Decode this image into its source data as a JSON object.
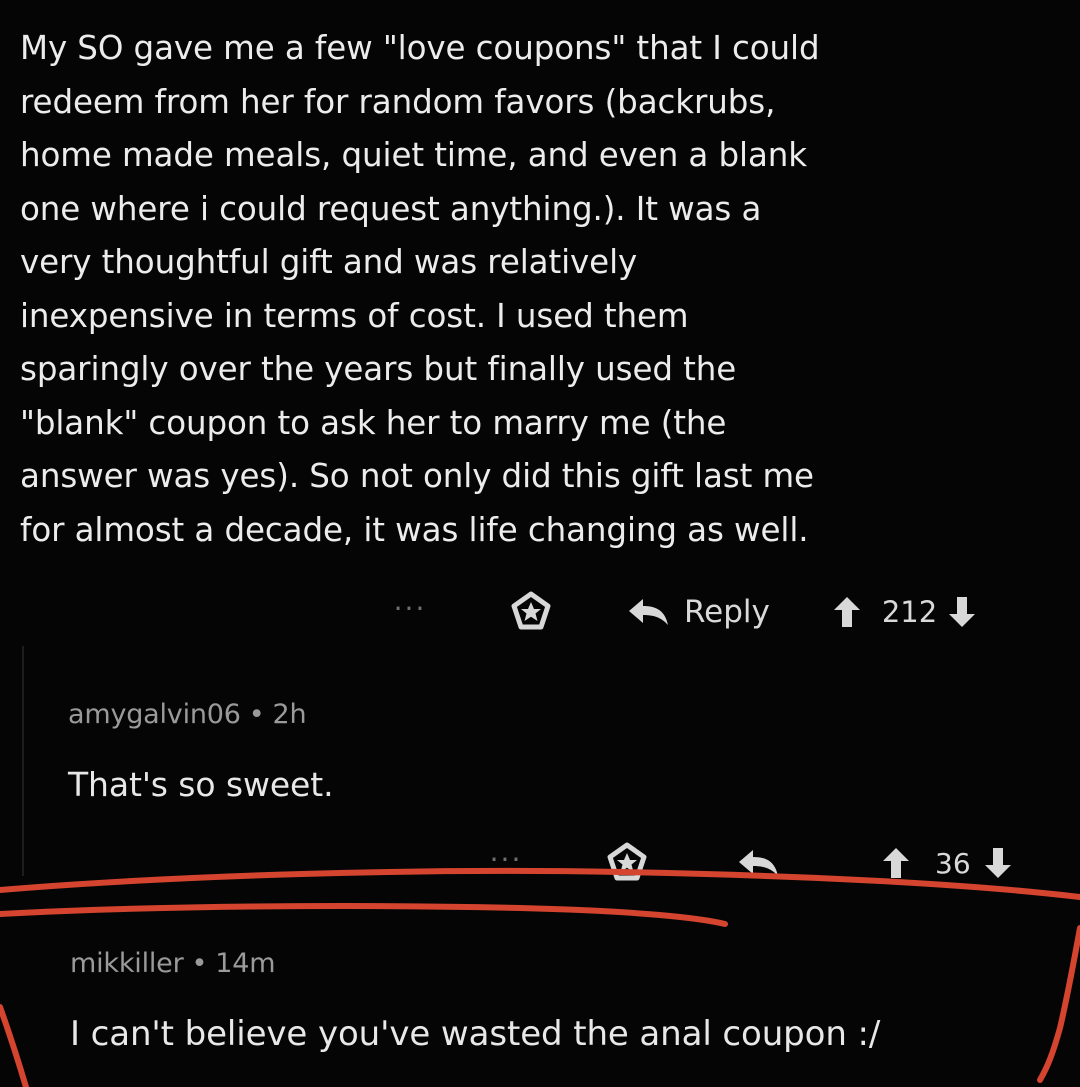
{
  "main_comment": {
    "body": "My SO gave me a few \"love coupons\" that I could\nredeem from her for random favors (backrubs,\nhome made meals, quiet time, and even a blank\none where i could request anything.). It was a\nvery thoughtful gift and was relatively\ninexpensive in terms of cost. I used them\nsparingly over the years but finally used the\n\"blank\" coupon to ask her to marry me (the\nanswer was yes). So not only did this gift last me\nfor almost a decade, it was life changing as well.",
    "actions": {
      "more": "···",
      "reply_label": "Reply",
      "score": "212"
    }
  },
  "reply_1": {
    "username": "amygalvin06",
    "separator": "•",
    "time": "2h",
    "body": "That's so sweet.",
    "actions": {
      "more": "···",
      "score": "36"
    }
  },
  "reply_2": {
    "username": "mikkiller",
    "separator": "•",
    "time": "14m",
    "body": "I can't believe you've wasted the anal coupon :/"
  },
  "colors": {
    "background": "#000000",
    "text": "#e6e6e6",
    "meta": "#9a9a9a",
    "annotation_red": "#d4442f"
  }
}
